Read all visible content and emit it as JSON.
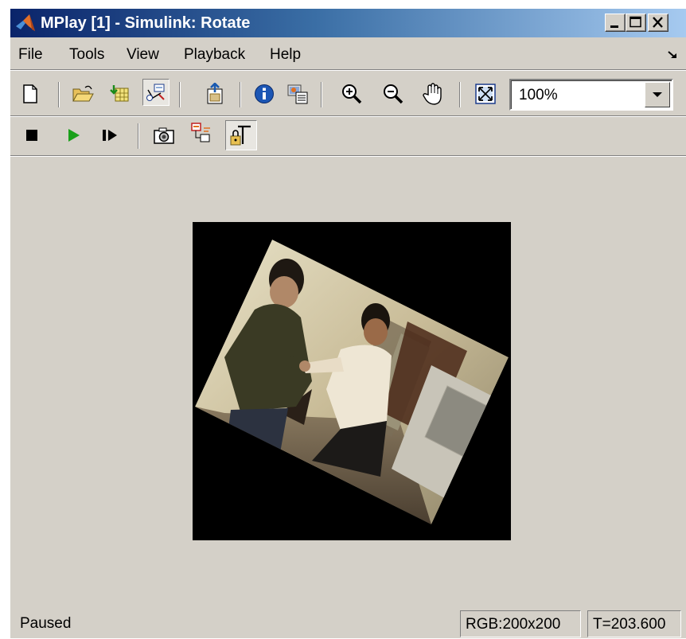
{
  "window": {
    "title": "MPlay [1] - Simulink: Rotate"
  },
  "menu": {
    "items": [
      "File",
      "Tools",
      "View",
      "Playback",
      "Help"
    ]
  },
  "toolbar1": {
    "icons": [
      "new-document-icon",
      "open-folder-icon",
      "import-from-workspace-icon",
      "connect-to-simulink-icon",
      "export-to-image-tool-icon",
      "info-icon",
      "colormap-icon",
      "zoom-in-icon",
      "zoom-out-icon",
      "pan-hand-icon",
      "maintain-fit-to-window-icon"
    ],
    "zoom_value": "100%"
  },
  "toolbar2": {
    "icons": [
      "stop-icon",
      "play-icon",
      "step-forward-icon",
      "snapshot-icon",
      "highlight-simulink-signal-icon",
      "floating-signal-lock-icon"
    ]
  },
  "status": {
    "state": "Paused",
    "dimensions": "RGB:200x200",
    "time": "T=203.600"
  },
  "colors": {
    "title_gradient_start": "#0a246a",
    "title_gradient_end": "#a6caf0",
    "chrome": "#d4d0c8",
    "video_background": "#000000"
  }
}
